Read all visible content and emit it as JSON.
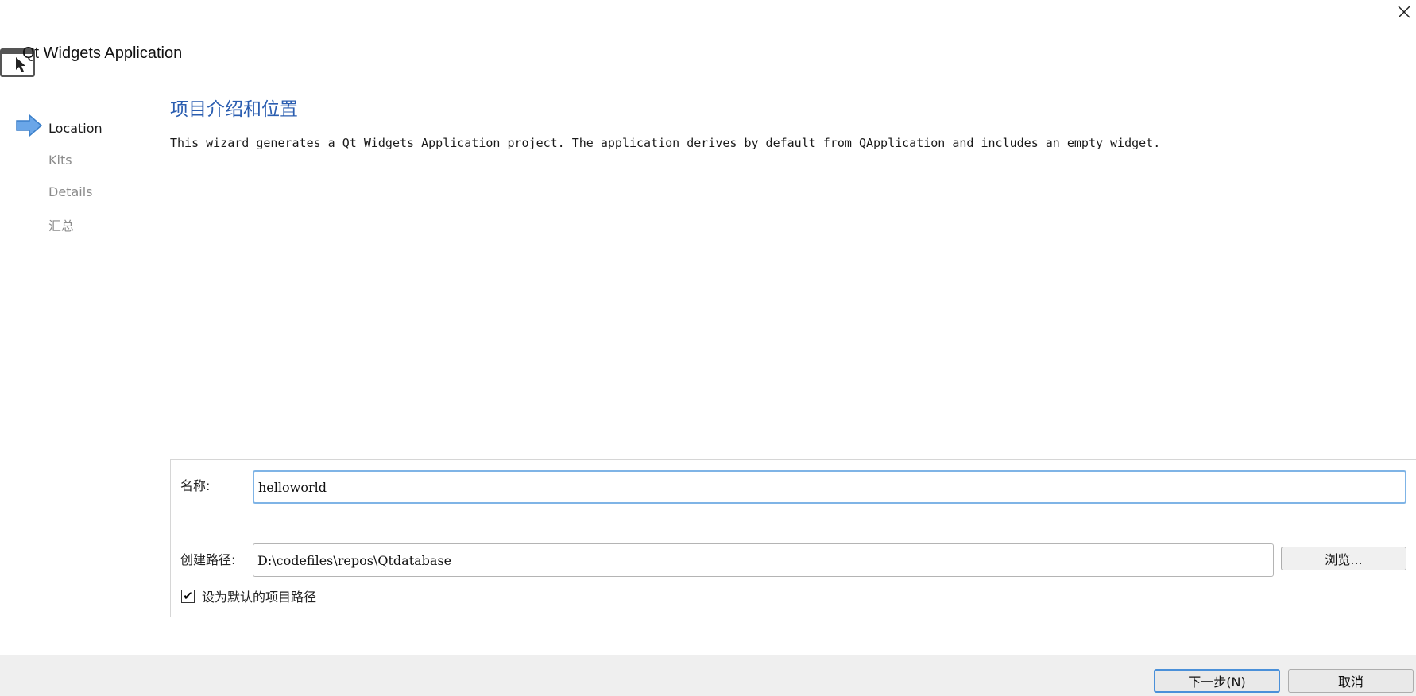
{
  "window": {
    "title": "Qt Widgets Application",
    "close_glyph": "✕"
  },
  "steps": [
    {
      "label": "Location",
      "current": true
    },
    {
      "label": "Kits",
      "current": false
    },
    {
      "label": "Details",
      "current": false
    },
    {
      "label": "汇总",
      "current": false
    }
  ],
  "page": {
    "heading": "项目介绍和位置",
    "description": "This wizard generates a Qt Widgets Application project. The application derives by default from QApplication and includes an empty widget."
  },
  "form": {
    "name_label": "名称:",
    "name_value": "helloworld",
    "path_label": "创建路径:",
    "path_value": "D:\\codefiles\\repos\\Qtdatabase",
    "browse_label": "浏览...",
    "default_path_label": "设为默认的项目路径",
    "default_path_checked": true,
    "check_glyph": "✔"
  },
  "buttons": {
    "next_label": "下一步(N)",
    "cancel_label": "取消"
  },
  "colors": {
    "heading": "#2a5db0",
    "focus_border": "#7fb4e6",
    "arrow": "#4a90d9"
  },
  "icons": {
    "app": "window-with-cursor-icon",
    "current_step": "arrow-right-icon",
    "close": "close-icon"
  }
}
